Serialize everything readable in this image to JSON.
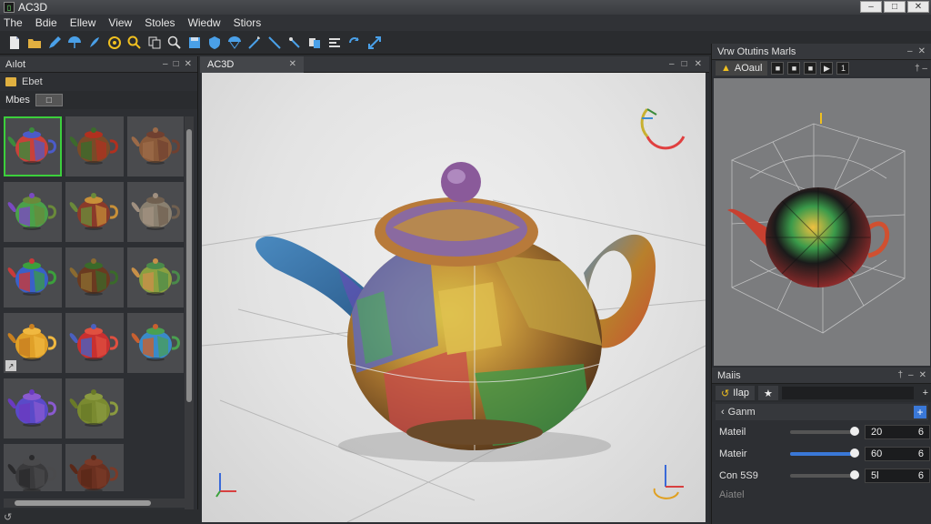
{
  "window": {
    "title": "AC3D"
  },
  "menu": [
    "The",
    "Bdie",
    "Ellew",
    "View",
    "Stoles",
    "Wiedw",
    "Stiors"
  ],
  "toolbar_icons": [
    "new-file",
    "open-folder",
    "pen",
    "umbrella",
    "brush",
    "circle-target",
    "magnifier-plus",
    "copy",
    "magnifier",
    "save",
    "shield",
    "parachute",
    "wand",
    "line",
    "pen-slash",
    "duplicate",
    "align",
    "rotate-arrows",
    "scale-arrows"
  ],
  "left_panel": {
    "title": "Aılot",
    "folder_label": "Ebet",
    "mat_tab": "Mbes",
    "mat_tab_btn": "□",
    "status": "↺"
  },
  "thumbnails": [
    {
      "colors": [
        "#c8413a",
        "#3c8a3c",
        "#4b5bc8"
      ],
      "selected": true
    },
    {
      "colors": [
        "#7a4a28",
        "#3c6a2c",
        "#b0301f"
      ]
    },
    {
      "colors": [
        "#8a5a3a",
        "#9b6a48",
        "#704030"
      ]
    },
    {
      "colors": [
        "#4ba04a",
        "#7a4ac0",
        "#6a8a3a"
      ]
    },
    {
      "colors": [
        "#8a3a2a",
        "#6a8a3a",
        "#c89038"
      ]
    },
    {
      "colors": [
        "#8a8070",
        "#a09080",
        "#706050"
      ]
    },
    {
      "colors": [
        "#3a60c8",
        "#c83a3a",
        "#3ca03c"
      ]
    },
    {
      "colors": [
        "#6a3a20",
        "#8a6a30",
        "#3a6a2a"
      ]
    },
    {
      "colors": [
        "#8aa040",
        "#c89048",
        "#4a8a4a"
      ]
    },
    {
      "colors": [
        "#e0a028",
        "#c88020",
        "#f0b840"
      ],
      "badge": "↗"
    },
    {
      "colors": [
        "#c83030",
        "#4a60c0",
        "#e05040"
      ]
    },
    {
      "colors": [
        "#3a8ac8",
        "#c86030",
        "#4aa050"
      ]
    },
    {
      "colors": [
        "#5a4ac8",
        "#6a3ac0",
        "#8a5ad0"
      ]
    },
    {
      "colors": [
        "#7a8a30",
        "#6a7a28",
        "#8a9a40"
      ]
    },
    {
      "empty": true
    },
    {
      "colors": [
        "#3a3a3c",
        "#2a2a2c",
        "#4a4a4c"
      ]
    },
    {
      "colors": [
        "#6a3020",
        "#5a2818",
        "#7a3a28"
      ]
    },
    {
      "empty": true
    }
  ],
  "viewport": {
    "tab_label": "AC3D"
  },
  "right_panel": {
    "title": "Vrw Otutins Marls",
    "preview_tab": "AOaul",
    "preview_btns": [
      "■",
      "■",
      "■",
      "▶",
      "1"
    ]
  },
  "properties": {
    "title": "Maiis",
    "tab_label": "Ilap",
    "section_label": "Ganm",
    "rows": [
      {
        "name": "Mateil",
        "value": "20",
        "unit": "6",
        "fill": 0.95
      },
      {
        "name": "Mateir",
        "value": "60",
        "unit": "6",
        "fill": 0.95
      },
      {
        "name": "Con 5S9",
        "value": "5l",
        "unit": "6",
        "fill": 0.95
      }
    ],
    "footer": "Aiatel"
  },
  "accent_color": "#3a78d8",
  "selection_color": "#3ccf3c"
}
